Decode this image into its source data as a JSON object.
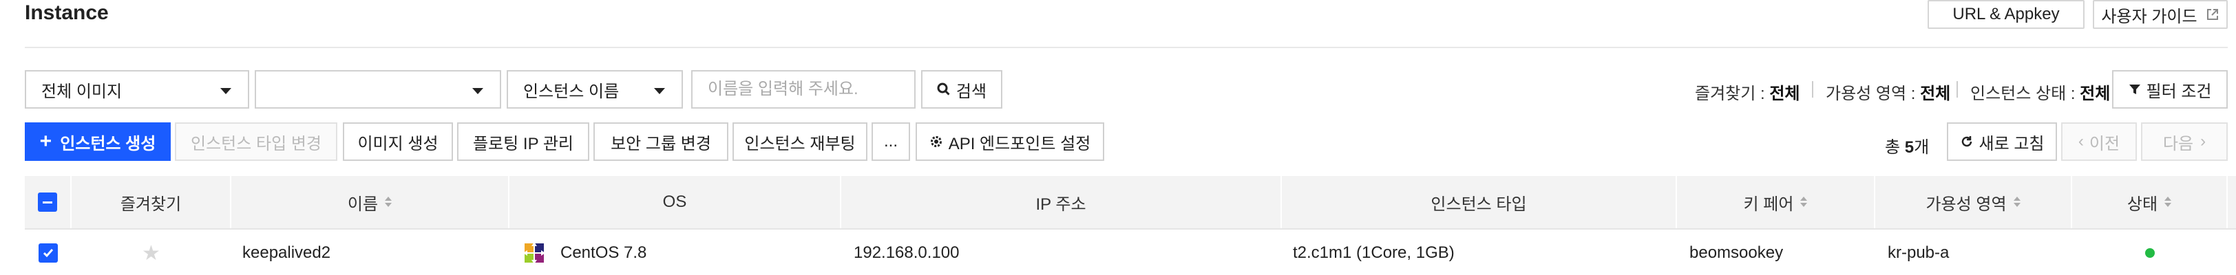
{
  "header": {
    "title": "Instance",
    "url_appkey": "URL & Appkey",
    "user_guide": "사용자 가이드"
  },
  "search": {
    "image_filter": "전체 이미지",
    "second_filter": "",
    "field_select": "인스턴스 이름",
    "placeholder": "이름을 입력해 주세요.",
    "search_label": "검색"
  },
  "filters": {
    "favorites_label": "즐겨찾기 :",
    "favorites_value": "전체",
    "zone_label": "가용성 영역 :",
    "zone_value": "전체",
    "state_label": "인스턴스 상태 :",
    "state_value": "전체",
    "filter_button": "필터 조건"
  },
  "toolbar": {
    "create": "인스턴스 생성",
    "change_type": "인스턴스 타입 변경",
    "create_image": "이미지 생성",
    "floating_ip": "플로팅 IP 관리",
    "security_group": "보안 그룹 변경",
    "reboot": "인스턴스 재부팅",
    "more": "...",
    "api_endpoint": "API 엔드포인트 설정",
    "total_prefix": "총",
    "total_count": "5",
    "total_suffix": "개",
    "refresh": "새로 고침",
    "prev": "이전",
    "next": "다음"
  },
  "table": {
    "columns": [
      "즐겨찾기",
      "이름",
      "OS",
      "IP 주소",
      "인스턴스 타입",
      "키 페어",
      "가용성 영역",
      "상태"
    ],
    "rows": [
      {
        "favorite": "★",
        "name": "keepalived2",
        "os": "CentOS 7.8",
        "ip": "192.168.0.100",
        "type": "t2.c1m1 (1Core, 1GB)",
        "keypair": "beomsookey",
        "zone": "kr-pub-a",
        "status_color": "#22bb44"
      }
    ]
  },
  "colors": {
    "primary": "#1a5cff",
    "header_bg": "#f3f3f3"
  }
}
